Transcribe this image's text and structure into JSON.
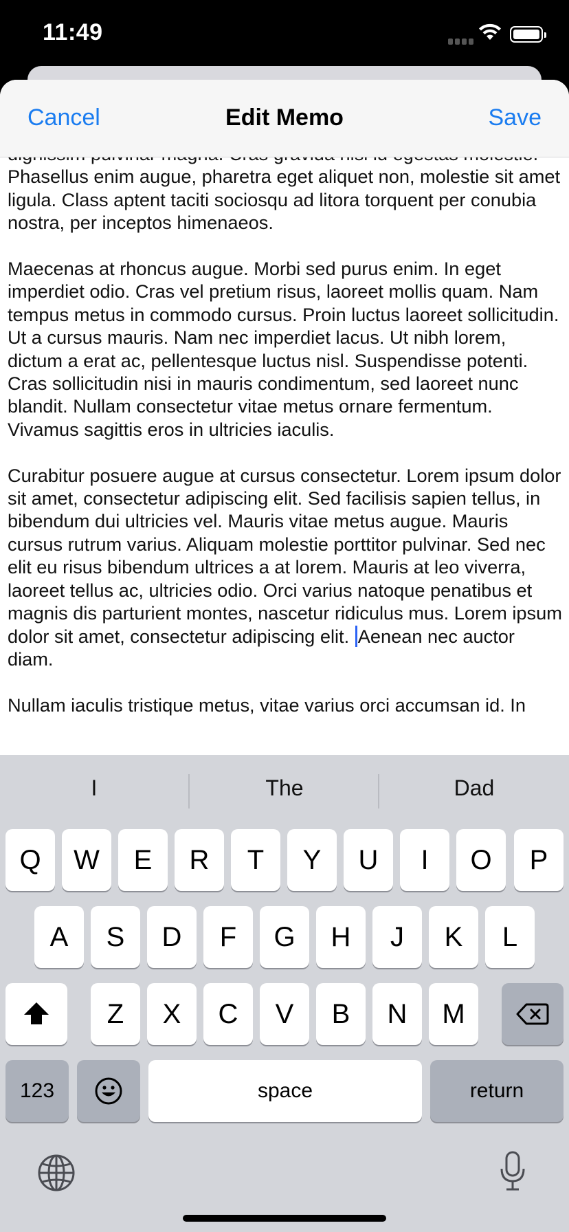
{
  "status_bar": {
    "time": "11:49"
  },
  "nav": {
    "cancel": "Cancel",
    "title": "Edit Memo",
    "save": "Save"
  },
  "editor": {
    "paragraphs": [
      "dignissim pulvinar magna. Cras gravida nisl id egestas molestie. Phasellus enim augue, pharetra eget aliquet non, molestie sit amet ligula. Class aptent taciti sociosqu ad litora torquent per conubia nostra, per inceptos himenaeos.",
      "Maecenas at rhoncus augue. Morbi sed purus enim. In eget imperdiet odio. Cras vel pretium risus, laoreet mollis quam. Nam tempus metus in commodo cursus. Proin luctus laoreet sollicitudin. Ut a cursus mauris. Nam nec imperdiet lacus. Ut nibh lorem, dictum a erat ac, pellentesque luctus nisl. Suspendisse potenti. Cras sollicitudin nisi in mauris condimentum, sed laoreet nunc blandit. Nullam consectetur vitae metus ornare fermentum. Vivamus sagittis eros in ultricies iaculis."
    ],
    "paragraph3_before_caret": "Curabitur posuere augue at cursus consectetur. Lorem ipsum dolor sit amet, consectetur adipiscing elit. Sed facilisis sapien tellus, in bibendum dui ultricies vel. Mauris vitae metus augue. Mauris cursus rutrum varius. Aliquam molestie porttitor pulvinar. Sed nec elit eu risus bibendum ultrices a at lorem. Mauris at leo viverra, laoreet tellus ac, ultricies odio. Orci varius natoque penatibus et magnis dis parturient montes, nascetur ridiculus mus. Lorem ipsum dolor sit amet, consectetur adipiscing elit. ",
    "paragraph3_after_caret": "Aenean nec auctor diam.",
    "paragraph4": "Nullam iaculis tristique metus, vitae varius orci accumsan id. In"
  },
  "keyboard": {
    "suggestions": [
      "I",
      "The",
      "Dad"
    ],
    "row1": [
      "Q",
      "W",
      "E",
      "R",
      "T",
      "Y",
      "U",
      "I",
      "O",
      "P"
    ],
    "row2": [
      "A",
      "S",
      "D",
      "F",
      "G",
      "H",
      "J",
      "K",
      "L"
    ],
    "row3": [
      "Z",
      "X",
      "C",
      "V",
      "B",
      "N",
      "M"
    ],
    "numbers_key": "123",
    "space_key": "space",
    "return_key": "return"
  },
  "colors": {
    "accent": "#1a7cf0",
    "caret": "#2b62f5",
    "keyboard_bg": "#d3d5da"
  }
}
